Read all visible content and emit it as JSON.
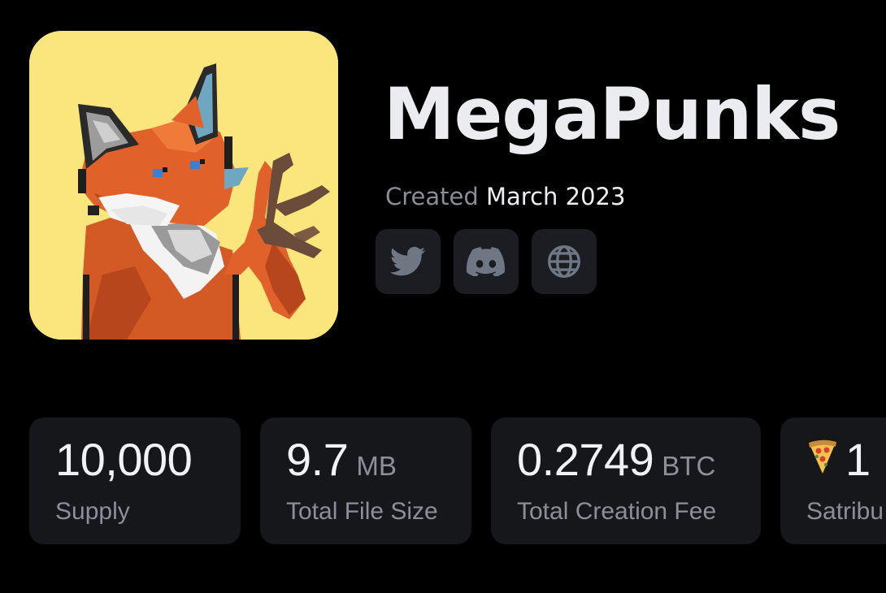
{
  "collection": {
    "name": "MegaPunks",
    "created_label": "Created",
    "created_value": "March 2023",
    "avatar_icon": "pixel-fox-icon",
    "avatar_bg": "#fbe67e"
  },
  "socials": [
    {
      "name": "twitter",
      "icon": "twitter-icon"
    },
    {
      "name": "discord",
      "icon": "discord-icon"
    },
    {
      "name": "website",
      "icon": "globe-icon"
    }
  ],
  "stats": [
    {
      "value": "10,000",
      "unit": "",
      "label": "Supply"
    },
    {
      "value": "9.7",
      "unit": "MB",
      "label": "Total File Size"
    },
    {
      "value": "0.2749",
      "unit": "BTC",
      "label": "Total Creation Fee"
    },
    {
      "value": "1",
      "unit": "",
      "label": "Satribu",
      "icon": "pizza-icon"
    }
  ],
  "colors": {
    "background": "#000000",
    "card": "#16171b",
    "social_button": "#1c1d22",
    "muted_text": "#8c8f9a",
    "fox_orange": "#e0622a"
  }
}
